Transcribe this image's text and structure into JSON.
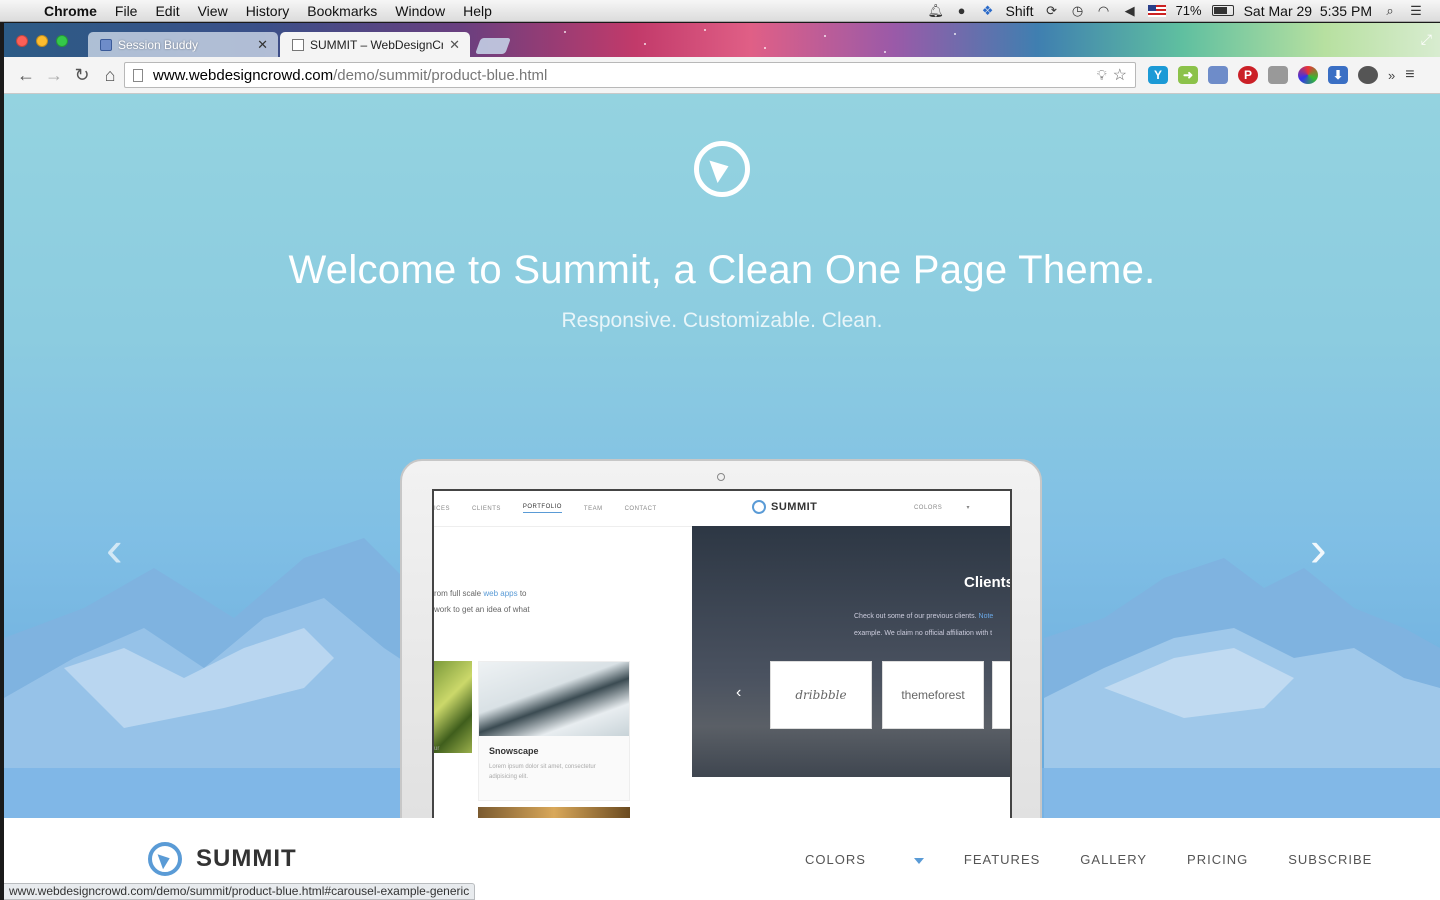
{
  "menubar": {
    "app": "Chrome",
    "items": [
      "File",
      "Edit",
      "View",
      "History",
      "Bookmarks",
      "Window",
      "Help"
    ],
    "keyboard_mode": "Shift",
    "battery": "71%",
    "clock": "Sat Mar 29  5:35 PM"
  },
  "tabs": [
    {
      "title": "Session Buddy",
      "icon": "session-buddy-icon"
    },
    {
      "title": "SUMMIT – WebDesignCrow",
      "icon": "document-icon"
    }
  ],
  "omnibox": {
    "host": "www.webdesigncrowd.com",
    "path": "/demo/summit/product-blue.html"
  },
  "hero": {
    "title": "Welcome to Summit, a Clean One Page Theme.",
    "subtitle": "Responsive. Customizable. Clean."
  },
  "mockup": {
    "nav": [
      "ICES",
      "CLIENTS",
      "PORTFOLIO",
      "TEAM",
      "CONTACT"
    ],
    "active": "PORTFOLIO",
    "brand": "SUMMIT",
    "colors_label": "COLORS",
    "intro_line1_pre": "rom full scale ",
    "intro_link": "web apps",
    "intro_line1_post": " to",
    "intro_line2": "work to get an idea of what",
    "card_title": "Snowscape",
    "card_text_1": "Lorem ipsum dolor sit amet, consectetur",
    "card_text_2": "adipisicing elit.",
    "side_label": "ur",
    "clients_title": "Clients",
    "clients_text_1_pre": "Check out some of our previous clients. ",
    "clients_text_1_link": "Note",
    "clients_text_2": "example. We claim no official affiliation with t",
    "client_logos": [
      "dribbble",
      "themeforest"
    ]
  },
  "site_nav": {
    "brand": "SUMMIT",
    "menu": [
      "COLORS",
      "FEATURES",
      "GALLERY",
      "PRICING",
      "SUBSCRIBE"
    ]
  },
  "status_bar": "www.webdesigncrowd.com/demo/summit/product-blue.html#carousel-example-generic",
  "colors": {
    "accent": "#5a9bd6",
    "hero_top": "#94d3e0",
    "hero_bottom": "#5fa2d7"
  }
}
